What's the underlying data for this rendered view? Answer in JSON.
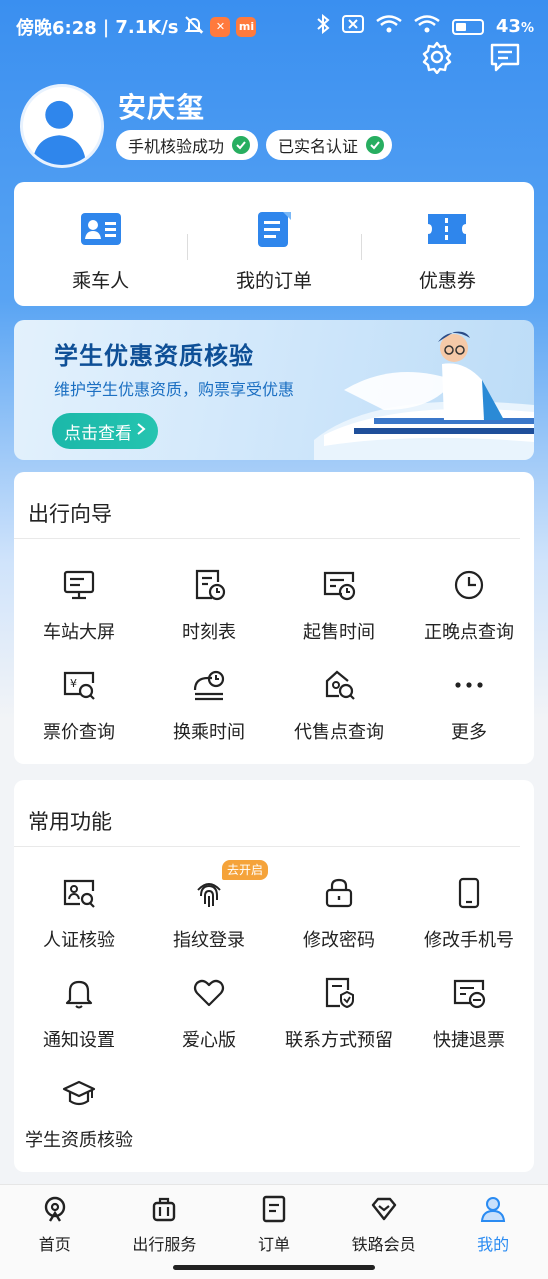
{
  "status_bar": {
    "time": "傍晚6:28",
    "speed": "7.1K/s",
    "battery": "43",
    "battery_unit": "%",
    "battery_level": 0.43
  },
  "profile": {
    "name": "安庆玺",
    "badges": [
      "手机核验成功",
      "已实名认证"
    ]
  },
  "quick_links": [
    {
      "label": "乘车人",
      "icon": "passenger-icon"
    },
    {
      "label": "我的订单",
      "icon": "order-icon"
    },
    {
      "label": "优惠券",
      "icon": "coupon-icon"
    }
  ],
  "banner": {
    "title": "学生优惠资质核验",
    "subtitle": "维护学生优惠资质，购票享受优惠",
    "button": "点击查看"
  },
  "travel_guide": {
    "title": "出行向导",
    "items": [
      {
        "label": "车站大屏",
        "icon": "station-screen-icon"
      },
      {
        "label": "时刻表",
        "icon": "timetable-icon"
      },
      {
        "label": "起售时间",
        "icon": "sale-time-icon"
      },
      {
        "label": "正晚点查询",
        "icon": "clock-icon"
      },
      {
        "label": "票价查询",
        "icon": "fare-search-icon"
      },
      {
        "label": "换乘时间",
        "icon": "transfer-time-icon"
      },
      {
        "label": "代售点查询",
        "icon": "agency-search-icon"
      },
      {
        "label": "更多",
        "icon": "more-icon"
      }
    ]
  },
  "common_functions": {
    "title": "常用功能",
    "tag": "去开启",
    "items": [
      {
        "label": "人证核验",
        "icon": "id-verify-icon"
      },
      {
        "label": "指纹登录",
        "icon": "fingerprint-icon"
      },
      {
        "label": "修改密码",
        "icon": "lock-icon"
      },
      {
        "label": "修改手机号",
        "icon": "phone-icon"
      },
      {
        "label": "通知设置",
        "icon": "bell-icon"
      },
      {
        "label": "爱心版",
        "icon": "heart-icon"
      },
      {
        "label": "联系方式预留",
        "icon": "contact-icon"
      },
      {
        "label": "快捷退票",
        "icon": "refund-icon"
      },
      {
        "label": "学生资质核验",
        "icon": "graduation-cap-icon"
      }
    ]
  },
  "bottom_nav": [
    {
      "label": "首页",
      "icon": "home-icon",
      "active": false
    },
    {
      "label": "出行服务",
      "icon": "luggage-icon",
      "active": false
    },
    {
      "label": "订单",
      "icon": "order-list-icon",
      "active": false
    },
    {
      "label": "铁路会员",
      "icon": "diamond-icon",
      "active": false
    },
    {
      "label": "我的",
      "icon": "person-icon",
      "active": true
    }
  ],
  "colors": {
    "primary": "#2a8bf2",
    "success": "#27ae60",
    "banner_button": "#1bb8a9",
    "tag": "#f5a33a"
  }
}
